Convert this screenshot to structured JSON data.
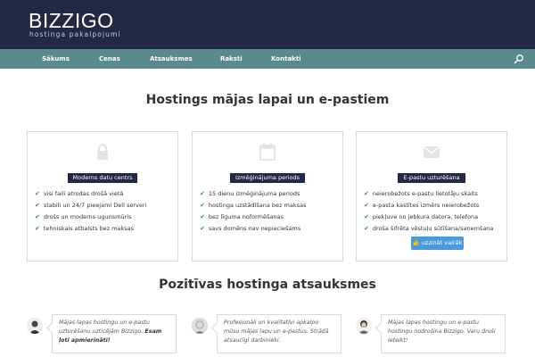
{
  "header": {
    "logo_title": "BIZZIGO",
    "logo_subtitle": "hostinga pakalpojumi"
  },
  "nav": {
    "items": [
      "Sākums",
      "Cenas",
      "Atsauksmes",
      "Raksti",
      "Kontakti"
    ],
    "search_icon": "search-icon"
  },
  "main": {
    "title": "Hostings mājas lapai un e-pastiem"
  },
  "features": [
    {
      "icon": "lock-icon",
      "title": "Moderns datu centrs",
      "items": [
        "visi faili atrodas drošā vietā",
        "stabili un 24/7 pieejami Dell serveri",
        "drošs un moderns ugunsmūris",
        "tehniskais atbalsts bez maksas"
      ]
    },
    {
      "icon": "calendar-icon",
      "title": "Izmēģinājuma periods",
      "items": [
        "15 dienu izmēģinājuma periods",
        "hostinga uzstādīšana bez maksas",
        "bez līguma noformēšanas",
        "savs domēns nav nepieciešams"
      ]
    },
    {
      "icon": "envelope-icon",
      "title": "E-pastu uzturēšana",
      "items": [
        "neierobežots e-pastu lietotāju skaits",
        "e-pasta kastītes izmērs neierobežots",
        "piekļuve no jebkura datora, telefona",
        "droša šifrēta vēstuļu sūtīšana/saņemšana"
      ],
      "button": "uzzināt vairāk"
    }
  ],
  "testimonials_section": {
    "title": "Pozitīvas hostinga atsauksmes",
    "items": [
      {
        "text": "Mājas lapas hostingu un e-pastu uzturēšanu uzticējām Bizzigo.",
        "bold": " Esam ļoti apmierināti!"
      },
      {
        "text": "Profesionāli un kvalitatīvi apkalpo mūsu mājas lapu un e-pastus. Strādā atsaucīgi darbinieki.",
        "bold": ""
      },
      {
        "text": "Mājas lapas hostingu un e-pastu hostingu nodrošina Bizzigo. Varu droši ieteikt!",
        "bold": ""
      }
    ]
  },
  "colors": {
    "header_bg": "#232944",
    "nav_bg": "#5a8a8e",
    "check": "#2e9c46",
    "button": "#4a9ae0"
  }
}
